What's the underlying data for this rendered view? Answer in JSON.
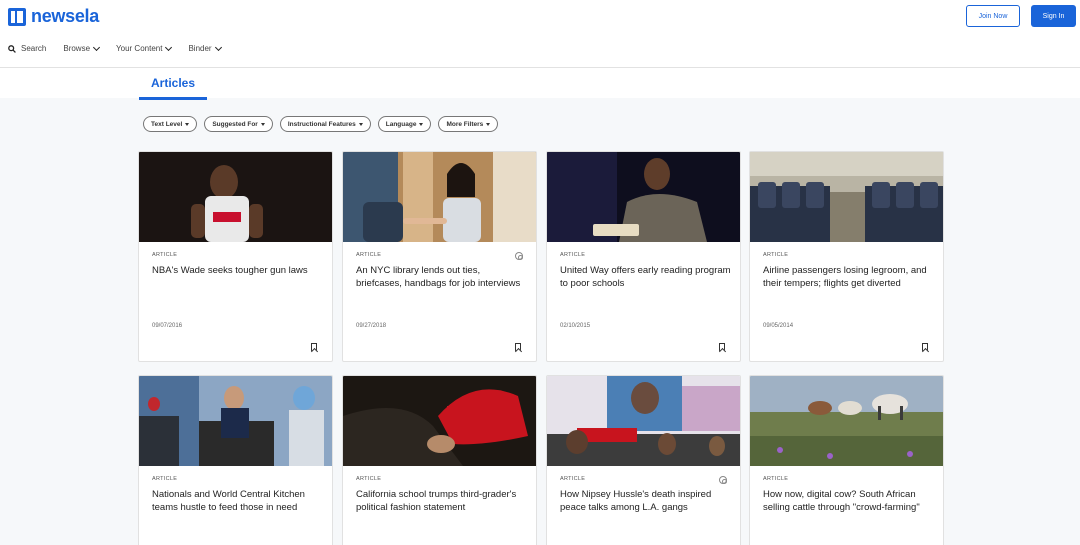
{
  "brand": {
    "name": "newsela"
  },
  "nav": {
    "search": "Search",
    "browse": "Browse",
    "your_content": "Your Content",
    "binder": "Binder"
  },
  "auth": {
    "join": "Join Now",
    "sign_in": "Sign In"
  },
  "tabs": {
    "active": "Articles"
  },
  "filters": [
    "Text Level",
    "Suggested For",
    "Instructional Features",
    "Language",
    "More Filters"
  ],
  "colors": {
    "brand_blue": "#1a64d9",
    "page_bg": "#f6f8fa"
  },
  "cards": [
    {
      "label": "ARTICLE",
      "title": "NBA's Wade seeks tougher gun laws",
      "date": "09/07/2016",
      "image": "basketball-player-photo"
    },
    {
      "label": "ARTICLE",
      "title": "An NYC library lends out ties, briefcases, handbags for job interviews",
      "date": "09/27/2018",
      "image": "job-interview-handshake-photo"
    },
    {
      "label": "ARTICLE",
      "title": "United Way offers early reading program to poor schools",
      "date": "02/10/2015",
      "image": "man-reading-book-photo"
    },
    {
      "label": "ARTICLE",
      "title": "Airline passengers losing legroom, and their tempers; flights get diverted",
      "date": "09/05/2014",
      "image": "airplane-cabin-photo"
    },
    {
      "label": "ARTICLE",
      "title": "Nationals and World Central Kitchen teams hustle to feed those in need",
      "image": "workers-unloading-truck-photo"
    },
    {
      "label": "ARTICLE",
      "title": "California school trumps third-grader's political fashion statement",
      "image": "red-campaign-hat-photo"
    },
    {
      "label": "ARTICLE",
      "title": "How Nipsey Hussle's death inspired peace talks among L.A. gangs",
      "image": "mural-crowd-photo"
    },
    {
      "label": "ARTICLE",
      "title": "How now, digital cow? South African selling cattle through \"crowd-farming\"",
      "image": "cattle-field-photo"
    }
  ]
}
